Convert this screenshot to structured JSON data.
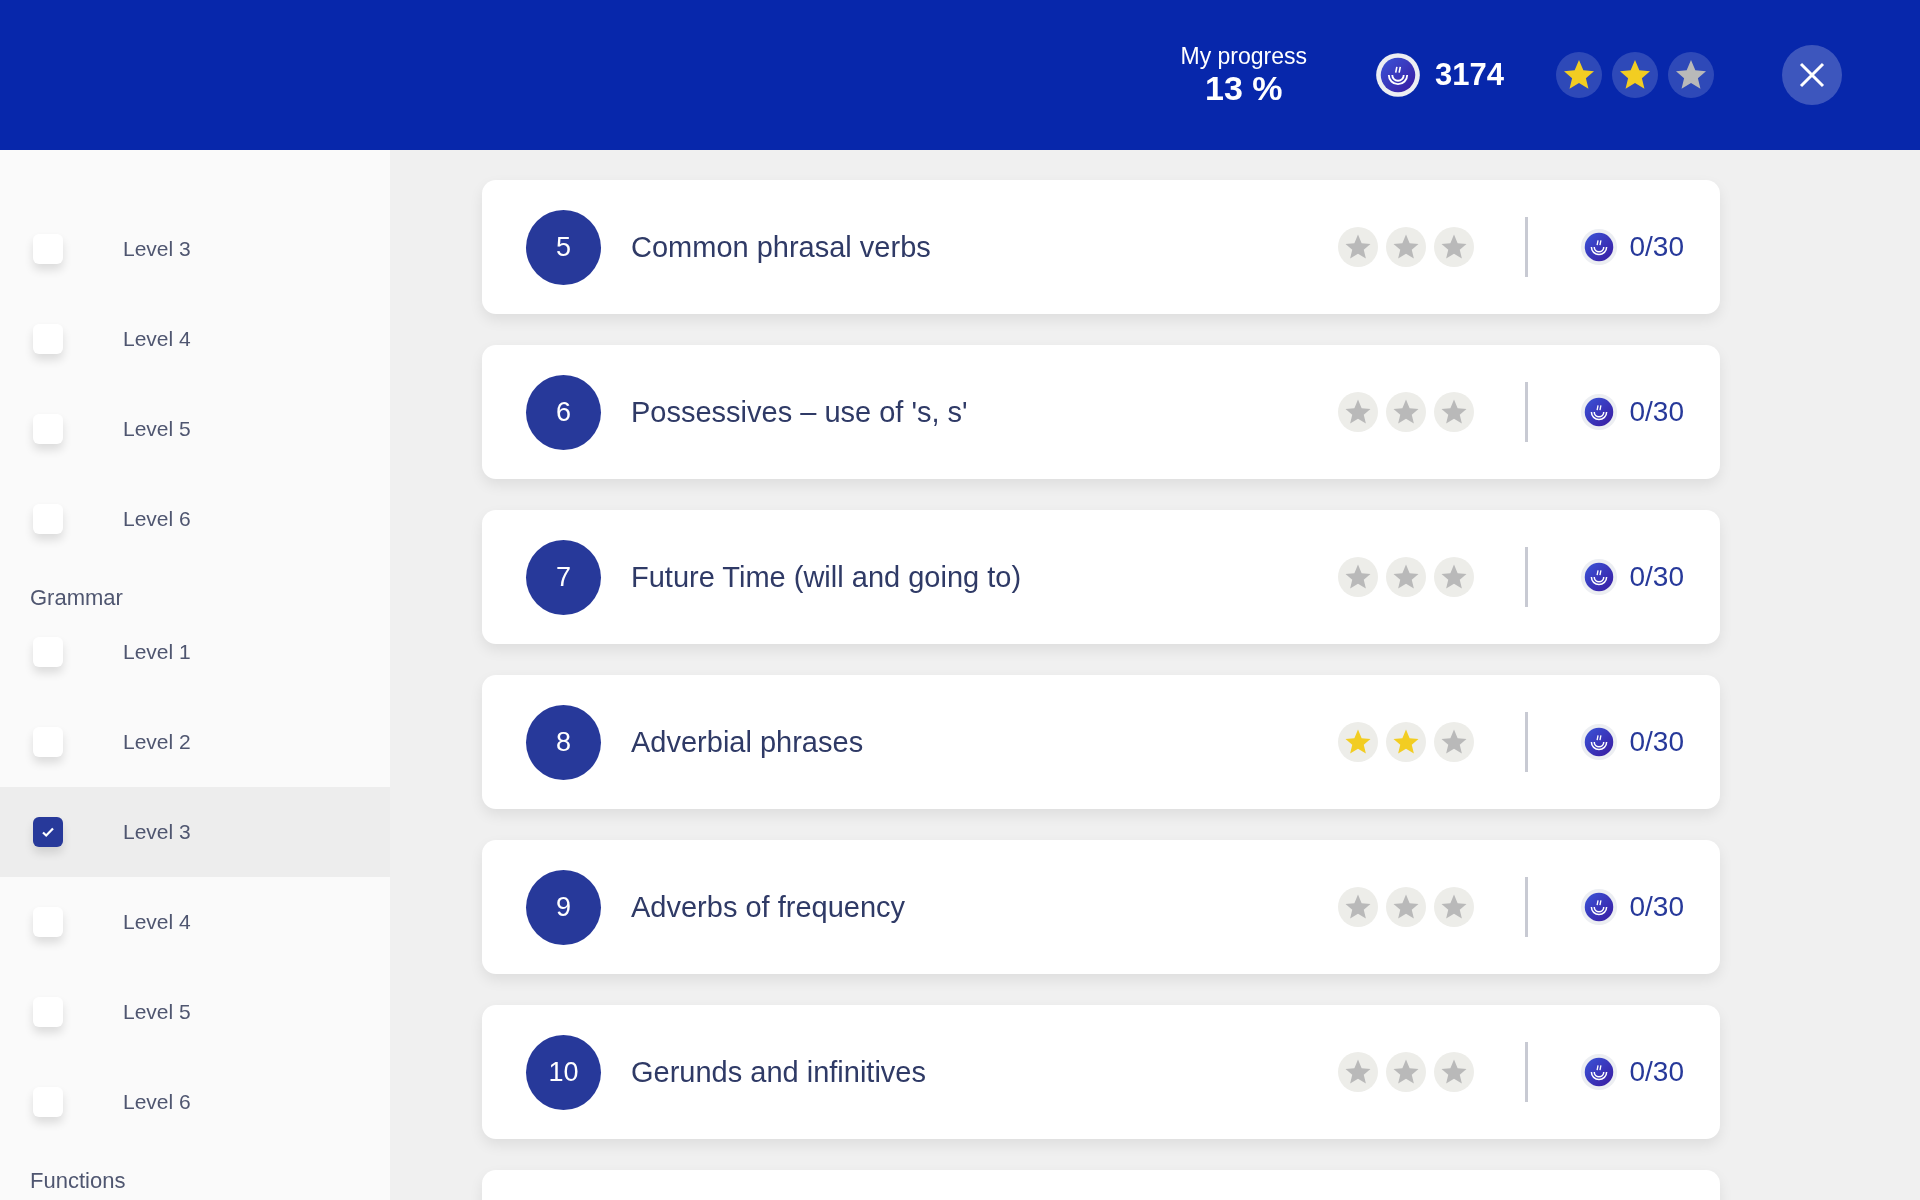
{
  "header": {
    "progress_label": "My progress",
    "progress_value": "13 %",
    "points": "3174",
    "stars": 2
  },
  "sidebar": {
    "sections": [
      {
        "items": [
          {
            "label": "Level 3",
            "checked": false,
            "selected": false
          },
          {
            "label": "Level 4",
            "checked": false,
            "selected": false
          },
          {
            "label": "Level 5",
            "checked": false,
            "selected": false
          },
          {
            "label": "Level 6",
            "checked": false,
            "selected": false
          }
        ]
      },
      {
        "title": "Grammar",
        "items": [
          {
            "label": "Level 1",
            "checked": false,
            "selected": false
          },
          {
            "label": "Level 2",
            "checked": false,
            "selected": false
          },
          {
            "label": "Level 3",
            "checked": true,
            "selected": true
          },
          {
            "label": "Level 4",
            "checked": false,
            "selected": false
          },
          {
            "label": "Level 5",
            "checked": false,
            "selected": false
          },
          {
            "label": "Level 6",
            "checked": false,
            "selected": false
          }
        ]
      },
      {
        "title": "Functions"
      }
    ]
  },
  "lessons": [
    {
      "number": "5",
      "title": "Common phrasal verbs",
      "stars": 0,
      "score": "0/30"
    },
    {
      "number": "6",
      "title": "Possessives – use of 's, s'",
      "stars": 0,
      "score": "0/30"
    },
    {
      "number": "7",
      "title": "Future Time (will and going to)",
      "stars": 0,
      "score": "0/30"
    },
    {
      "number": "8",
      "title": "Adverbial phrases",
      "stars": 2,
      "score": "0/30"
    },
    {
      "number": "9",
      "title": "Adverbs of frequency",
      "stars": 0,
      "score": "0/30"
    },
    {
      "number": "10",
      "title": "Gerunds and infinitives",
      "stars": 0,
      "score": "0/30"
    }
  ]
}
